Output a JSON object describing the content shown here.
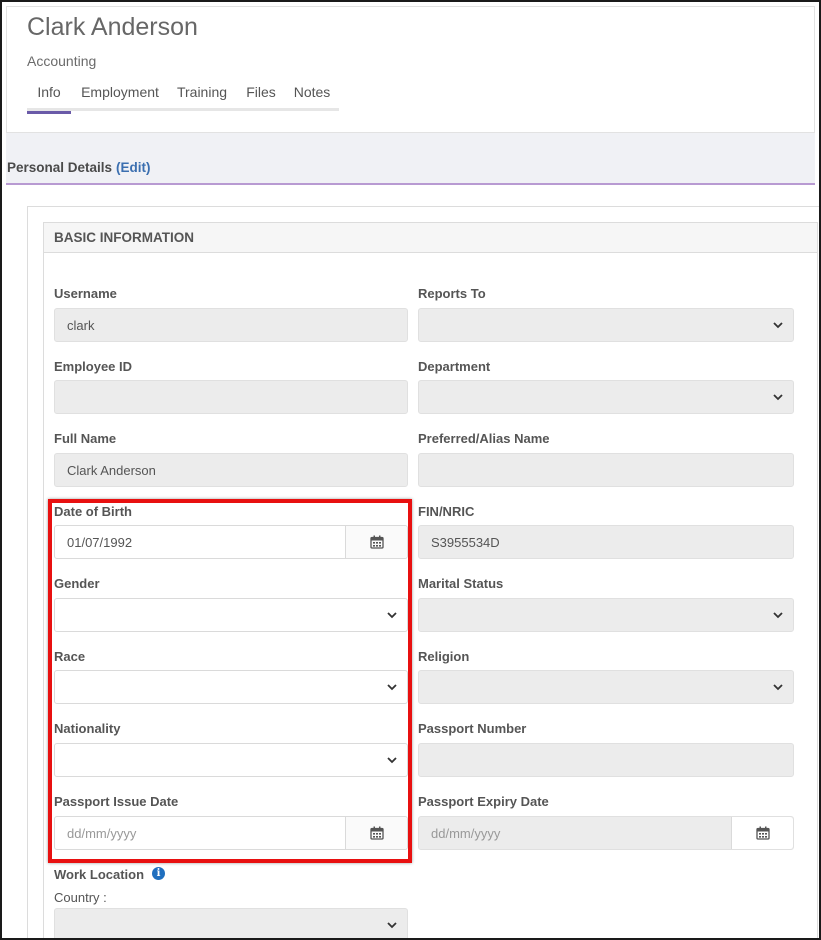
{
  "employee": {
    "name": "Clark Anderson",
    "department": "Accounting"
  },
  "tabs": [
    {
      "label": "Info",
      "active": true
    },
    {
      "label": "Employment",
      "active": false
    },
    {
      "label": "Training",
      "active": false
    },
    {
      "label": "Files",
      "active": false
    },
    {
      "label": "Notes",
      "active": false
    }
  ],
  "section": {
    "title": "Personal Details",
    "edit_label": "(Edit)"
  },
  "panel": {
    "title": "BASIC INFORMATION"
  },
  "fields": {
    "username": {
      "label": "Username",
      "value": "clark"
    },
    "reports_to": {
      "label": "Reports To",
      "value": ""
    },
    "employee_id": {
      "label": "Employee ID",
      "value": ""
    },
    "department": {
      "label": "Department",
      "value": ""
    },
    "full_name": {
      "label": "Full Name",
      "value": "Clark Anderson"
    },
    "preferred_name": {
      "label": "Preferred/Alias Name",
      "value": ""
    },
    "date_of_birth": {
      "label": "Date of Birth",
      "value": "01/07/1992"
    },
    "fin_nric": {
      "label": "FIN/NRIC",
      "value": "S3955534D"
    },
    "gender": {
      "label": "Gender",
      "value": ""
    },
    "marital_status": {
      "label": "Marital Status",
      "value": ""
    },
    "race": {
      "label": "Race",
      "value": ""
    },
    "religion": {
      "label": "Religion",
      "value": ""
    },
    "nationality": {
      "label": "Nationality",
      "value": ""
    },
    "passport_number": {
      "label": "Passport Number",
      "value": ""
    },
    "passport_issue_date": {
      "label": "Passport Issue Date",
      "placeholder": "dd/mm/yyyy"
    },
    "passport_expiry_date": {
      "label": "Passport Expiry Date",
      "placeholder": "dd/mm/yyyy"
    },
    "work_location": {
      "label": "Work Location",
      "country_label": "Country :"
    }
  },
  "icons": {
    "calendar": "calendar-icon",
    "chevron": "chevron-down-icon",
    "info": "info-icon"
  },
  "colors": {
    "accent": "#6a5aa8",
    "link": "#3b6fb0",
    "highlight": "#e81010",
    "section_line": "#b89ad2"
  }
}
